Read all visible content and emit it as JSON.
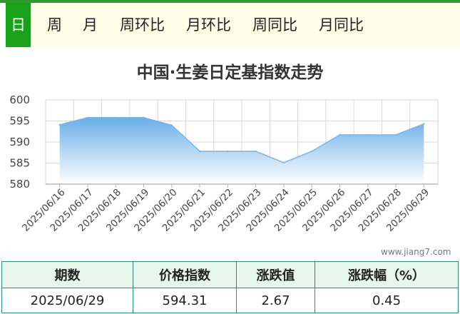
{
  "tabs": [
    {
      "label": "日",
      "active": true
    },
    {
      "label": "周",
      "active": false
    },
    {
      "label": "月",
      "active": false
    },
    {
      "label": "周环比",
      "active": false
    },
    {
      "label": "月环比",
      "active": false
    },
    {
      "label": "周同比",
      "active": false
    },
    {
      "label": "月同比",
      "active": false
    }
  ],
  "colors": {
    "accent": "#1aa01a",
    "area_top": "#6aaee8",
    "line": "#7ab4e8",
    "table_border": "#2e8c7c"
  },
  "chart_data": {
    "type": "area",
    "title": "中国·生姜日定基指数走势",
    "xlabel": "",
    "ylabel": "",
    "ylim": [
      580,
      600
    ],
    "yticks": [
      580,
      585,
      590,
      595,
      600
    ],
    "grid": true,
    "categories": [
      "2025/06/16",
      "2025/06/17",
      "2025/06/18",
      "2025/06/19",
      "2025/06/20",
      "2025/06/21",
      "2025/06/22",
      "2025/06/23",
      "2025/06/24",
      "2025/06/25",
      "2025/06/26",
      "2025/06/27",
      "2025/06/28",
      "2025/06/29"
    ],
    "values": [
      594.1,
      595.8,
      595.8,
      595.8,
      594.0,
      587.8,
      587.8,
      587.8,
      585.1,
      587.8,
      591.7,
      591.7,
      591.7,
      594.3
    ]
  },
  "watermark": "www.jiang7.com",
  "summary": {
    "headers": [
      "期数",
      "价格指数",
      "涨跌值",
      "涨跌幅（%）"
    ],
    "row": [
      "2025/06/29",
      "594.31",
      "2.67",
      "0.45"
    ]
  }
}
